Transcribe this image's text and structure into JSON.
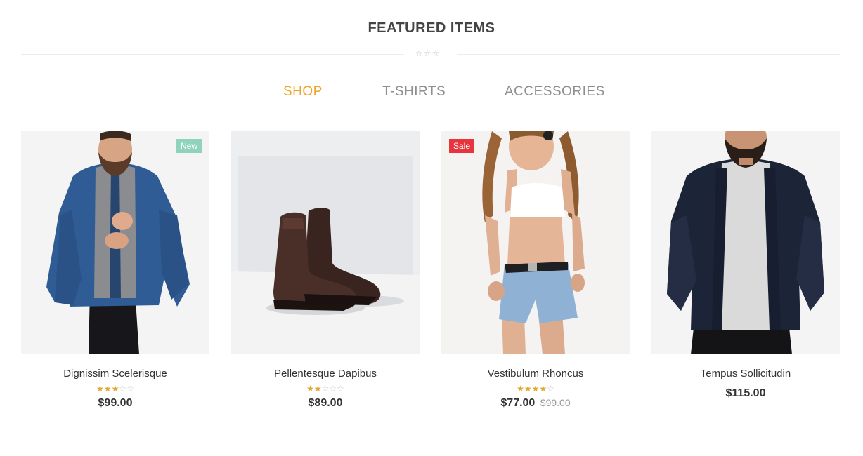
{
  "section": {
    "title": "FEATURED ITEMS"
  },
  "tabs": [
    {
      "label": "SHOP",
      "active": true
    },
    {
      "label": "T-SHIRTS",
      "active": false
    },
    {
      "label": "ACCESSORIES",
      "active": false
    }
  ],
  "colors": {
    "accent": "#f1a42b",
    "new_badge": "#8fd3bc",
    "sale_badge": "#e8343d",
    "star_filled": "#e0a72a",
    "star_empty": "#c8c8c8"
  },
  "products": [
    {
      "name": "Dignissim Scelerisque",
      "badge": "New",
      "rating": 3,
      "rating_max": 5,
      "price": "$99.00",
      "old_price": "",
      "image_icon": "denim-jacket-model-photo"
    },
    {
      "name": "Pellentesque Dapibus",
      "badge": "",
      "rating": 2,
      "rating_max": 5,
      "price": "$89.00",
      "old_price": "",
      "image_icon": "leather-boots-photo"
    },
    {
      "name": "Vestibulum Rhoncus",
      "badge": "Sale",
      "rating": 4,
      "rating_max": 5,
      "price": "$77.00",
      "old_price": "$99.00",
      "image_icon": "denim-shorts-model-photo"
    },
    {
      "name": "Tempus Sollicitudin",
      "badge": "",
      "rating": null,
      "rating_max": 5,
      "price": "$115.00",
      "old_price": "",
      "image_icon": "navy-bomber-model-photo"
    }
  ]
}
